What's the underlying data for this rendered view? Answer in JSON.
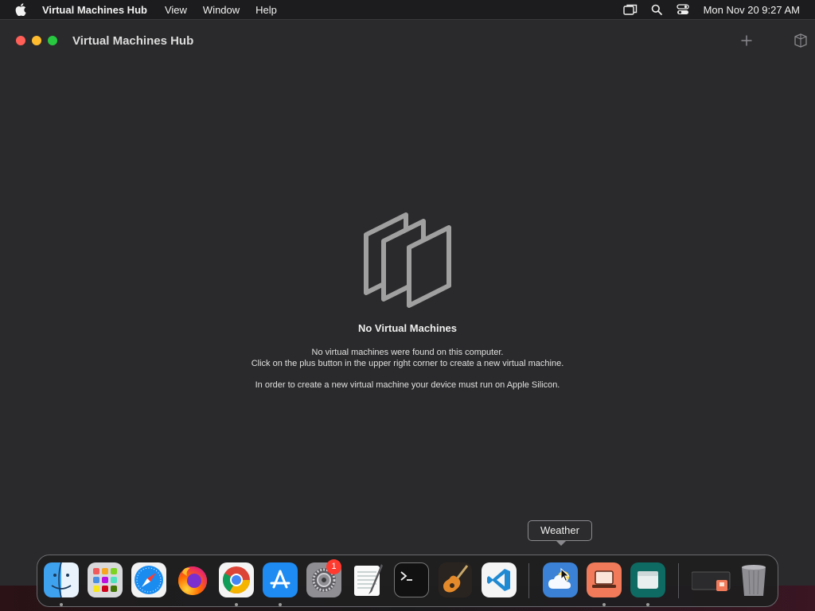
{
  "menubar": {
    "app_name": "Virtual Machines Hub",
    "menus": [
      "View",
      "Window",
      "Help"
    ],
    "clock": "Mon Nov 20  9:27 AM",
    "status_icons": [
      "screen-mirroring-icon",
      "spotlight-search-icon",
      "control-center-icon"
    ]
  },
  "window": {
    "title": "Virtual Machines Hub",
    "toolbar": {
      "add_icon": "plus-icon",
      "library_icon": "vm-library-icon"
    },
    "empty_state": {
      "icon": "stacked-vms-icon",
      "title": "No Virtual Machines",
      "line1": "No virtual machines were found on this computer.",
      "line2": "Click on the plus button in the upper right corner to create a new virtual machine.",
      "line3": "In order to create a new virtual machine your device must run on Apple Silicon."
    }
  },
  "tooltip": {
    "text": "Weather"
  },
  "dock": {
    "items": [
      {
        "name": "Finder",
        "running": true
      },
      {
        "name": "Launchpad",
        "running": false
      },
      {
        "name": "Safari",
        "running": false
      },
      {
        "name": "Firefox",
        "running": false
      },
      {
        "name": "Google Chrome",
        "running": true
      },
      {
        "name": "App Store",
        "running": true
      },
      {
        "name": "System Settings",
        "running": false,
        "badge": "1"
      },
      {
        "name": "TextEdit",
        "running": false
      },
      {
        "name": "Terminal",
        "running": false
      },
      {
        "name": "GarageBand",
        "running": false
      },
      {
        "name": "Visual Studio Code",
        "running": false
      },
      {
        "name": "Weather",
        "running": false
      },
      {
        "name": "Virtual Machines Hub",
        "running": true
      },
      {
        "name": "Archive Utility",
        "running": true
      },
      {
        "name": "Downloads stack",
        "running": false
      },
      {
        "name": "Trash",
        "running": false
      }
    ]
  }
}
